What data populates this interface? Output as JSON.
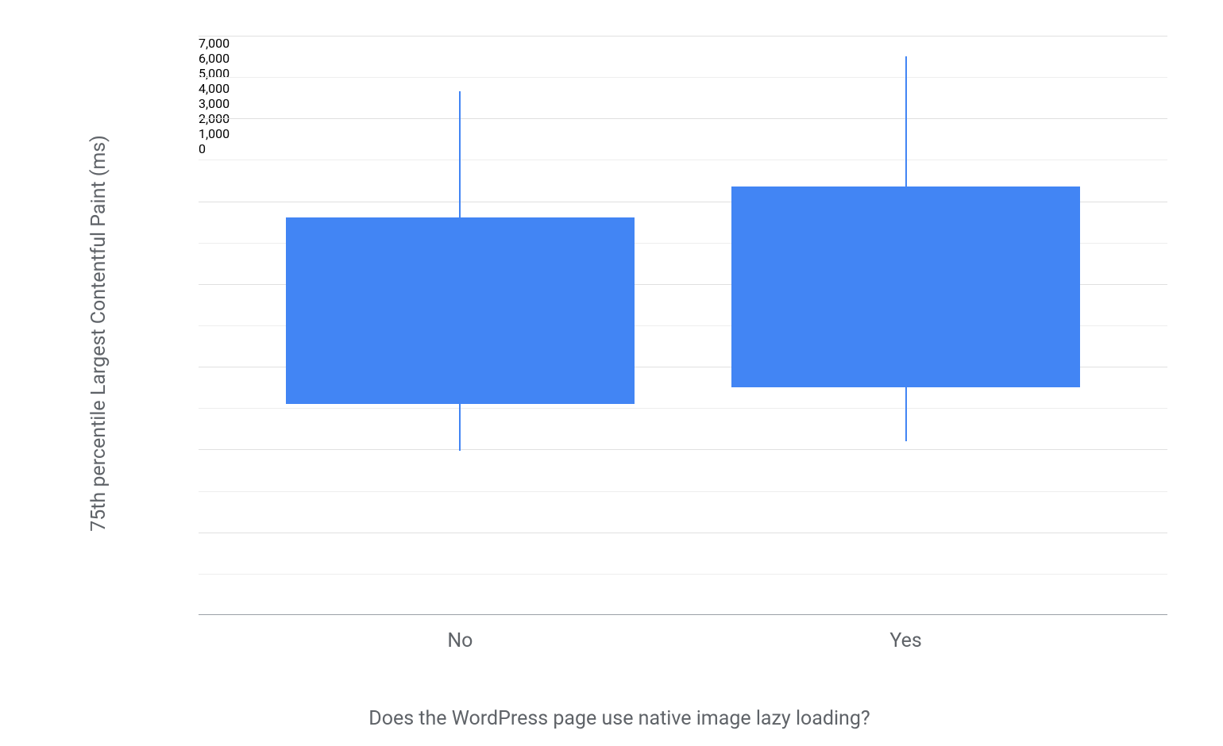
{
  "chart_data": {
    "type": "boxplot",
    "categories": [
      "No",
      "Yes"
    ],
    "series": [
      {
        "name": "No",
        "low": 1980,
        "q1": 2550,
        "q3": 4800,
        "high": 6330
      },
      {
        "name": "Yes",
        "low": 2100,
        "q1": 2750,
        "q3": 5180,
        "high": 6750
      }
    ],
    "xlabel": "Does the WordPress page use native image lazy loading?",
    "ylabel": "75th percentile Largest Contentful Paint (ms)",
    "ylim": [
      0,
      7000
    ],
    "y_ticks": [
      0,
      1000,
      2000,
      3000,
      4000,
      5000,
      6000,
      7000
    ],
    "y_tick_labels": [
      "0",
      "1,000",
      "2,000",
      "3,000",
      "4,000",
      "5,000",
      "6,000",
      "7,000"
    ],
    "bar_color": "#4285f4"
  }
}
